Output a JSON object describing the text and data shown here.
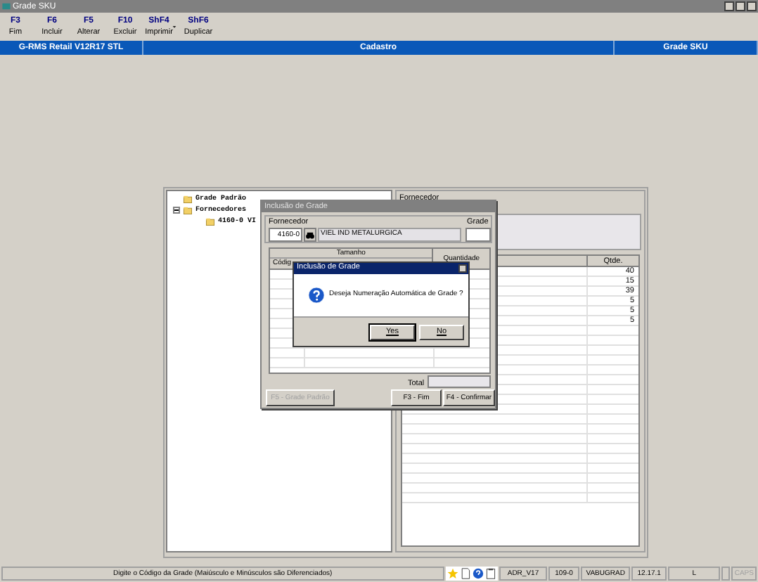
{
  "window": {
    "title": "Grade SKU"
  },
  "toolbar": [
    {
      "key": "F3",
      "label": "Fim",
      "dropdown": false
    },
    {
      "key": "F6",
      "label": "Incluir",
      "dropdown": false
    },
    {
      "key": "F5",
      "label": "Alterar",
      "dropdown": false
    },
    {
      "key": "F10",
      "label": "Excluir",
      "dropdown": false
    },
    {
      "key": "ShF4",
      "label": "Imprimir",
      "dropdown": true
    },
    {
      "key": "ShF6",
      "label": "Duplicar",
      "dropdown": false
    }
  ],
  "header_bar": [
    "G-RMS Retail V12R17 STL",
    "Cadastro",
    "Grade SKU"
  ],
  "tree": [
    {
      "label": "Grade Padrão"
    },
    {
      "label": "Fornecedores",
      "expanded": true,
      "children": [
        {
          "label": "4160-0 VI"
        }
      ]
    }
  ],
  "right_panel": {
    "label": "Fornecedor",
    "column": "Qtde.",
    "rows": [
      "40",
      "15",
      "39",
      "5",
      "5",
      "5"
    ]
  },
  "dialog": {
    "title": "Inclusão de Grade",
    "supplier_label": "Fornecedor",
    "supplier_code": "4160-0",
    "supplier_name": "VIEL IND METALURGICA",
    "grade_label": "Grade",
    "size_header": "Tamanho",
    "code_header": "Códig",
    "quantity_header": "Quantidade",
    "total_label": "Total",
    "buttons": [
      {
        "label": "F5 - Grade Padrão",
        "disabled": true
      },
      {
        "label": "F3 - Fim",
        "disabled": false
      },
      {
        "label": "F4 - Confirmar",
        "disabled": false
      }
    ]
  },
  "message_box": {
    "title": "Inclusão de Grade",
    "text": "Deseja Numeração Automática de Grade ?",
    "buttons": [
      {
        "label": "Yes",
        "default": true
      },
      {
        "label": "No",
        "default": false
      }
    ]
  },
  "status_bar": {
    "message": "Digite o Código da Grade (Maiúsculo e Minúsculos são Diferenciados)",
    "fields": [
      {
        "text": "ADR_V17",
        "disabled": false
      },
      {
        "text": "109-0",
        "disabled": false
      },
      {
        "text": "VABUGRAD",
        "disabled": false
      },
      {
        "text": "12.17.1",
        "disabled": false
      },
      {
        "text": "L",
        "disabled": false
      },
      {
        "text": "CAPS",
        "disabled": true
      }
    ]
  }
}
